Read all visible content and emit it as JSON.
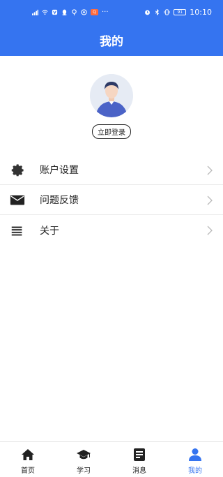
{
  "status_bar": {
    "badge": "Q",
    "more": "···",
    "battery": "91",
    "time": "10:10"
  },
  "header": {
    "title": "我的"
  },
  "profile": {
    "login_label": "立即登录"
  },
  "menu": {
    "items": [
      {
        "label": "账户设置",
        "icon": "gear-icon"
      },
      {
        "label": "问题反馈",
        "icon": "mail-icon"
      },
      {
        "label": "关于",
        "icon": "menu-lines-icon"
      }
    ]
  },
  "bottom_nav": {
    "items": [
      {
        "label": "首页",
        "icon": "home-icon"
      },
      {
        "label": "学习",
        "icon": "graduation-cap-icon"
      },
      {
        "label": "消息",
        "icon": "message-doc-icon"
      },
      {
        "label": "我的",
        "icon": "person-icon"
      }
    ],
    "active_index": 3
  },
  "colors": {
    "accent": "#3574f0",
    "text": "#222222",
    "divider": "#e8e8e8"
  }
}
